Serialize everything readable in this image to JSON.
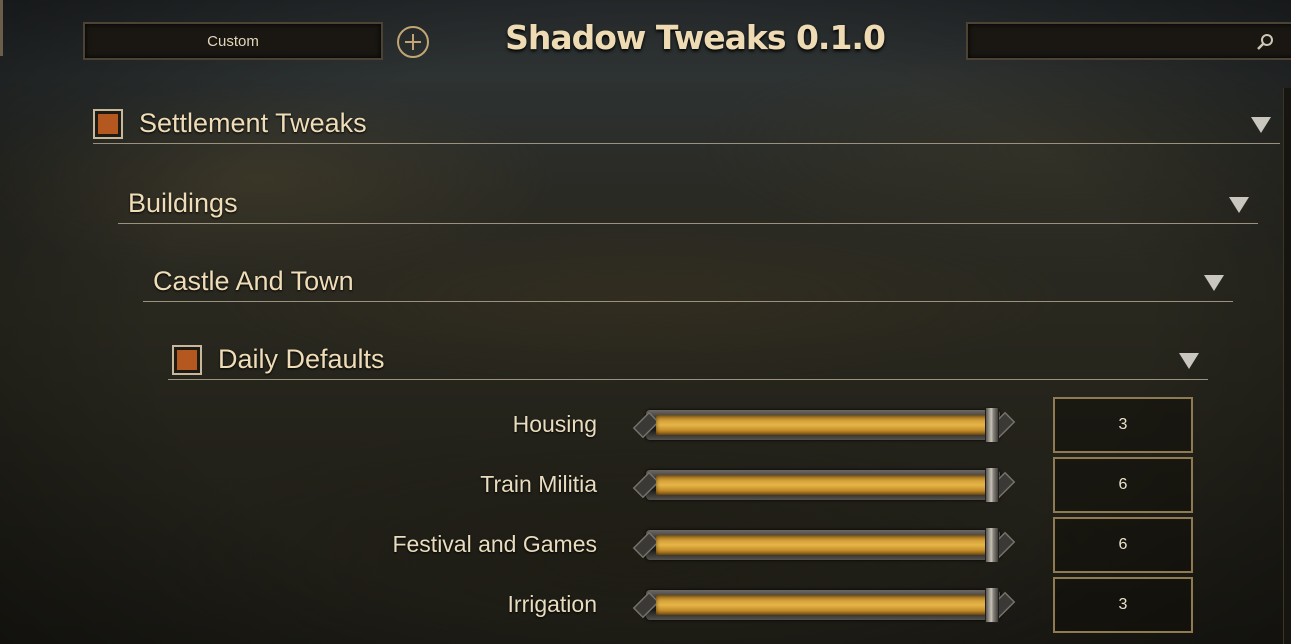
{
  "header": {
    "preset_label": "Custom",
    "title": "Shadow Tweaks 0.1.0",
    "search_value": ""
  },
  "groups": [
    {
      "label": "Settlement Tweaks",
      "has_checkbox": true,
      "checked": true
    },
    {
      "label": "Buildings",
      "has_checkbox": false
    },
    {
      "label": "Castle And Town",
      "has_checkbox": false
    },
    {
      "label": "Daily Defaults",
      "has_checkbox": true,
      "checked": true
    }
  ],
  "settings": [
    {
      "label": "Housing",
      "value": "3",
      "slider_fraction": 1.0
    },
    {
      "label": "Train Militia",
      "value": "6",
      "slider_fraction": 1.0
    },
    {
      "label": "Festival and Games",
      "value": "6",
      "slider_fraction": 1.0
    },
    {
      "label": "Irrigation",
      "value": "3",
      "slider_fraction": 1.0
    }
  ],
  "colors": {
    "accent_gold": "#d6a33c",
    "checkbox_fill": "#b4581f",
    "title_text": "#eedbb4"
  },
  "icons": {
    "add": "plus-circle-icon",
    "search": "magnifier-icon",
    "collapse": "triangle-down-icon"
  }
}
